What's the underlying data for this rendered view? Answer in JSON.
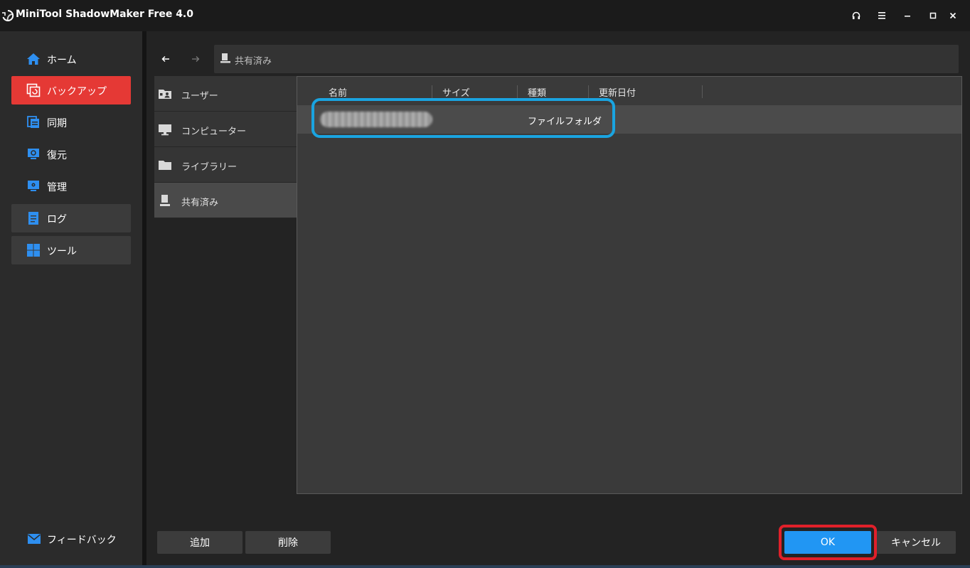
{
  "window": {
    "title": "MiniTool ShadowMaker Free 4.0",
    "controls": [
      {
        "name": "headset-icon"
      },
      {
        "name": "menu-icon"
      },
      {
        "name": "minimize-icon"
      },
      {
        "name": "maximize-icon"
      },
      {
        "name": "close-icon"
      }
    ]
  },
  "sidebar": {
    "items": [
      {
        "label": "ホーム",
        "icon": "home-icon"
      },
      {
        "label": "バックアップ",
        "icon": "backup-icon",
        "active": true
      },
      {
        "label": "同期",
        "icon": "sync-icon"
      },
      {
        "label": "復元",
        "icon": "restore-icon"
      },
      {
        "label": "管理",
        "icon": "manage-icon"
      },
      {
        "label": "ログ",
        "icon": "log-icon"
      },
      {
        "label": "ツール",
        "icon": "tools-icon"
      }
    ],
    "feedback": {
      "label": "フィードバック",
      "icon": "mail-icon"
    }
  },
  "browser": {
    "address": "共有済み",
    "locations": [
      {
        "label": "ユーザー",
        "icon": "user-folder-icon"
      },
      {
        "label": "コンピューター",
        "icon": "computer-icon"
      },
      {
        "label": "ライブラリー",
        "icon": "folder-icon"
      },
      {
        "label": "共有済み",
        "icon": "shared-folder-icon",
        "selected": true
      }
    ],
    "columns": [
      "名前",
      "サイズ",
      "種類",
      "更新日付"
    ],
    "rows": [
      {
        "type": "ファイルフォルダ"
      }
    ]
  },
  "buttons": {
    "add": "追加",
    "delete": "削除",
    "ok": "OK",
    "cancel": "キャンセル"
  },
  "colors": {
    "accent_red": "#e53935",
    "accent_blue": "#2196f3",
    "highlight_blue": "#1aa4e0",
    "highlight_red": "#e0202a"
  }
}
